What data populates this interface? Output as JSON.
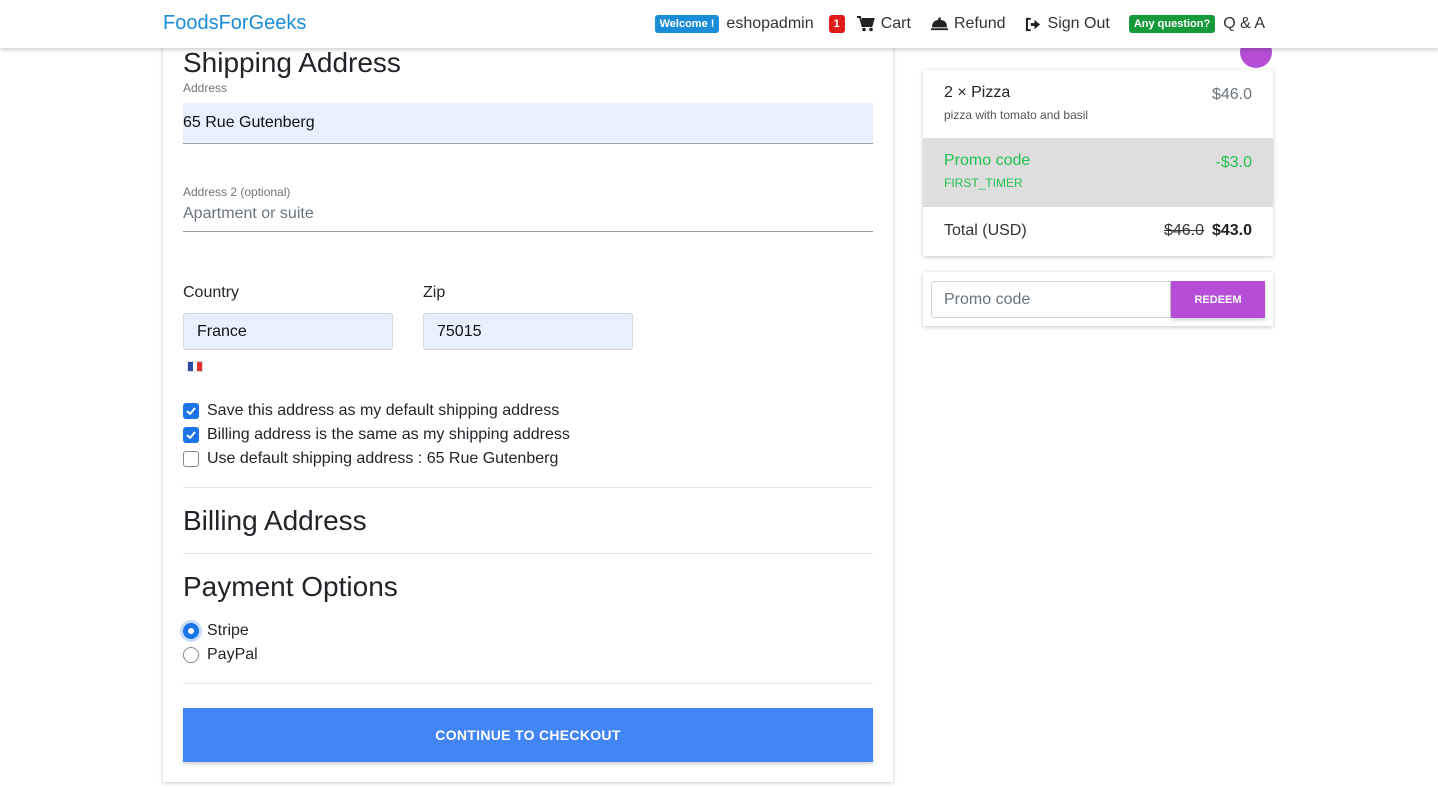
{
  "navbar": {
    "brand": "FoodsForGeeks",
    "welcome_badge": "Welcome !",
    "username": "eshopadmin",
    "cart_count": "1",
    "cart_label": "Cart",
    "refund_label": "Refund",
    "signout_label": "Sign Out",
    "question_badge": "Any question?",
    "qa_label": "Q & A"
  },
  "shipping": {
    "title": "Shipping Address",
    "address_label": "Address",
    "address_value": "65 Rue Gutenberg",
    "address2_label": "Address 2 (optional)",
    "address2_placeholder": "Apartment or suite",
    "country_label": "Country",
    "country_value": "France",
    "zip_label": "Zip",
    "zip_value": "75015",
    "options": [
      {
        "label": "Save this address as my default shipping address",
        "checked": true
      },
      {
        "label": "Billing address is the same as my shipping address",
        "checked": true
      },
      {
        "label": "Use default shipping address : 65 Rue Gutenberg",
        "checked": false
      }
    ]
  },
  "billing": {
    "title": "Billing Address"
  },
  "payment": {
    "title": "Payment Options",
    "methods": [
      {
        "label": "Stripe",
        "selected": true
      },
      {
        "label": "PayPal",
        "selected": false
      }
    ]
  },
  "checkout_button": "CONTINUE TO CHECKOUT",
  "cart": {
    "item": {
      "name": "2 × Pizza",
      "description": "pizza with tomato and basil",
      "price": "$46.0"
    },
    "promo": {
      "label": "Promo code",
      "code": "FIRST_TIMER",
      "discount": "-$3.0"
    },
    "total": {
      "label": "Total (USD)",
      "original": "$46.0",
      "final": "$43.0"
    }
  },
  "promo_form": {
    "placeholder": "Promo code",
    "redeem_label": "REDEEM"
  },
  "colors": {
    "brand": "#1a8cd8",
    "accent_button": "#4285f4",
    "promo_green": "#21c251",
    "redeem_purple": "#b54dd6"
  }
}
